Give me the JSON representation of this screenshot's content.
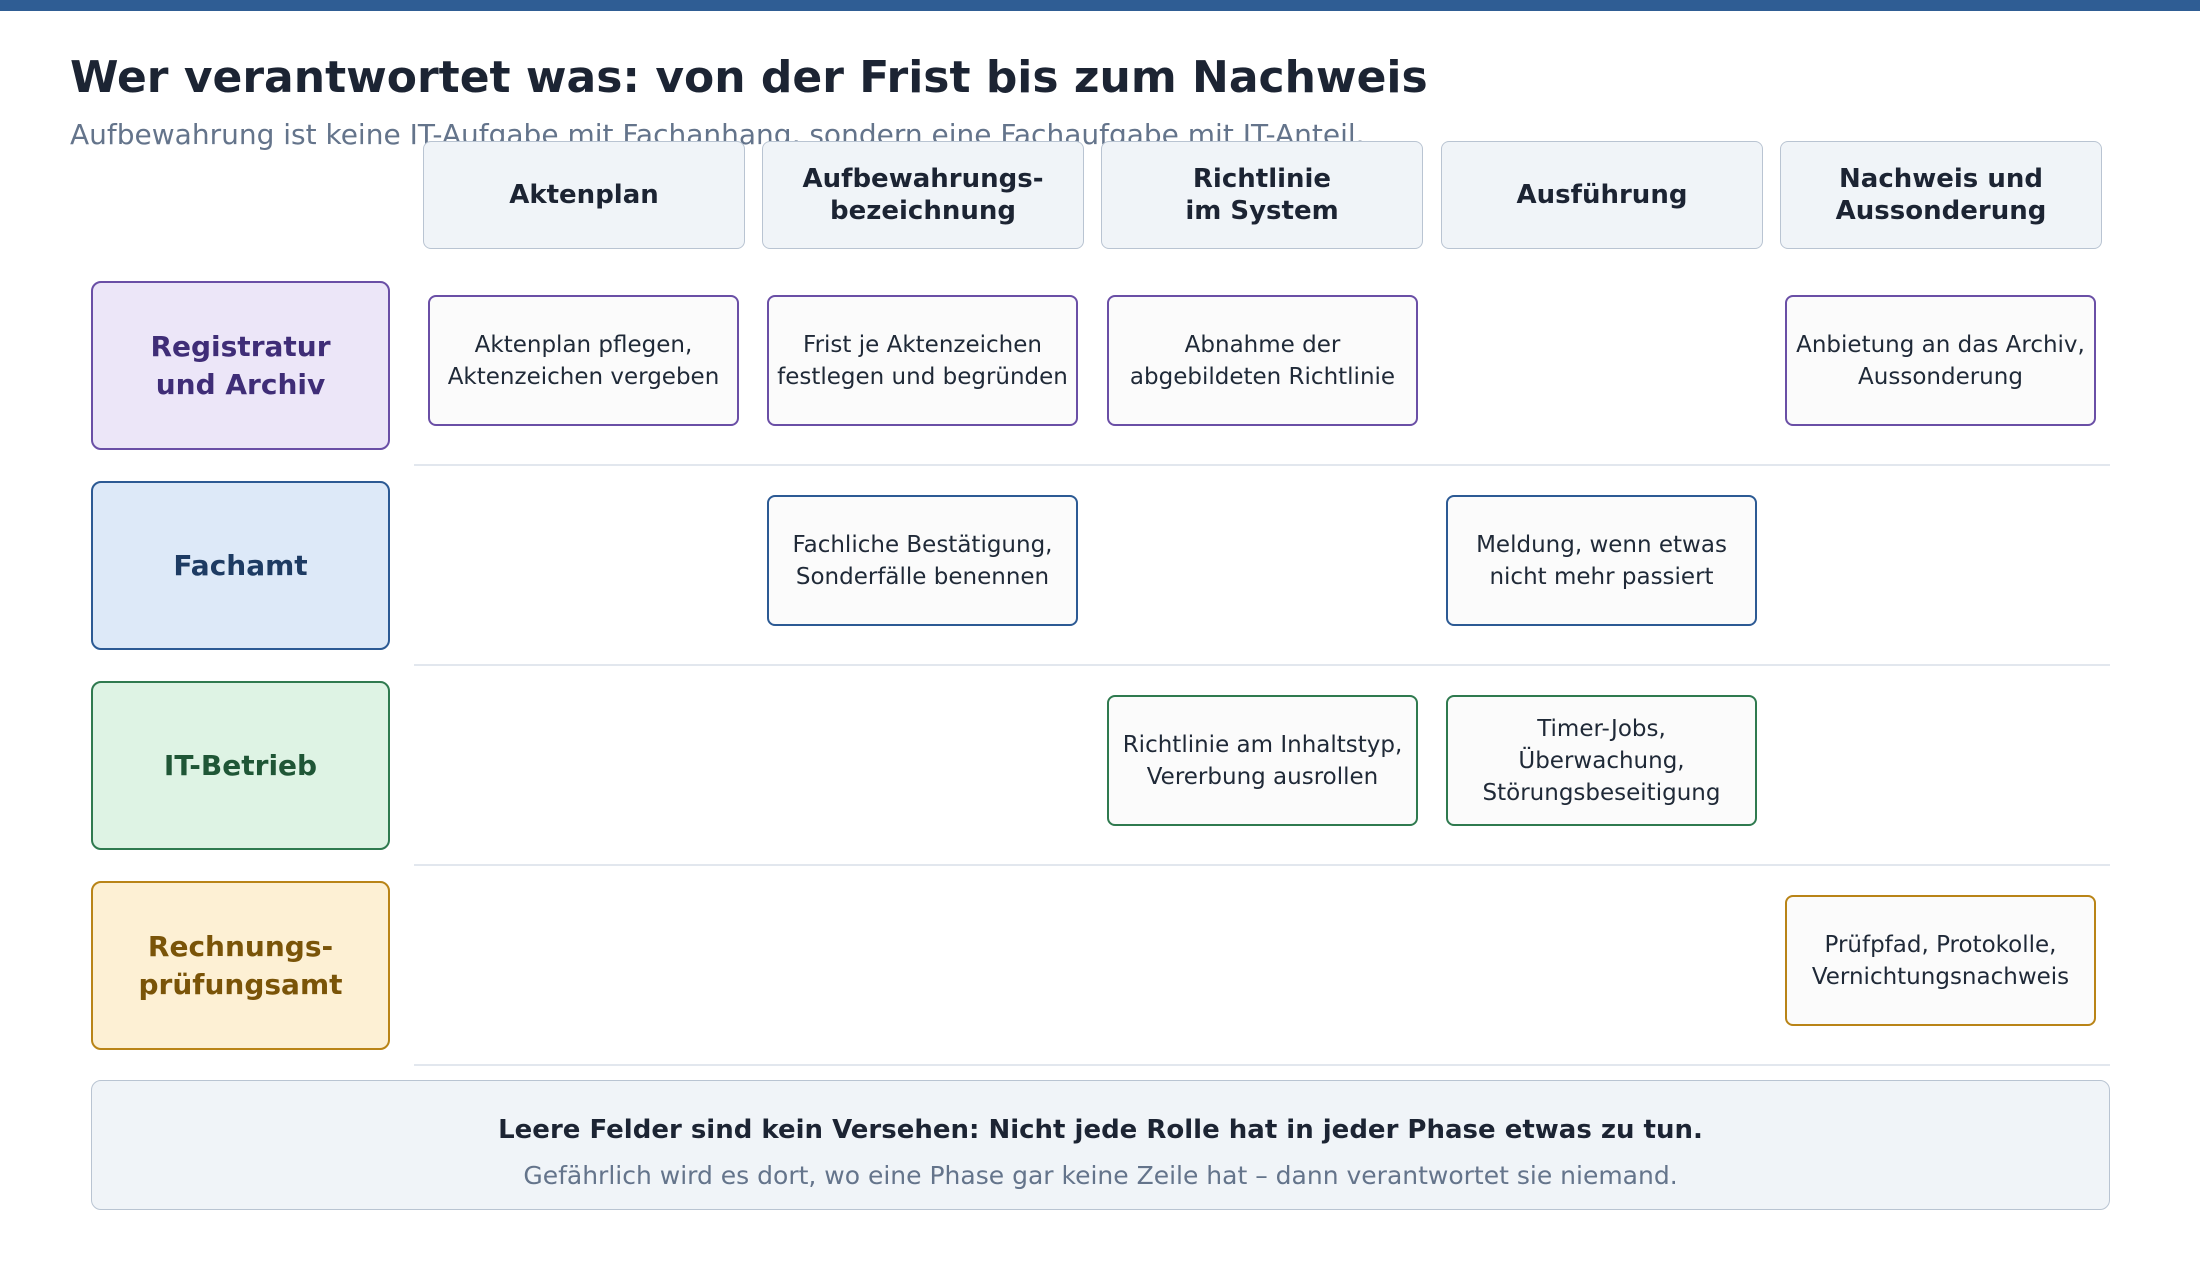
{
  "title": "Wer verantwortet was: von der Frist bis zum Nachweis",
  "subtitle": "Aufbewahrung ist keine IT-Aufgabe mit Fachanhang, sondern eine Fachaufgabe mit IT-Anteil.",
  "colors": {
    "top_bar": "#2f5d94",
    "registratur_border": "#6a4fa6",
    "registratur_fill": "#ece6f8",
    "registratur_text": "#3f2d77",
    "fachamt_border": "#2c5a94",
    "fachamt_fill": "#dde9f8",
    "fachamt_text": "#1d3b63",
    "it_border": "#2f7a4f",
    "it_fill": "#def3e4",
    "it_text": "#1f5636",
    "rpa_border": "#b98417",
    "rpa_fill": "#fdf0d4",
    "rpa_text": "#7a5408"
  },
  "phases": [
    {
      "label": "Aktenplan"
    },
    {
      "label": "Aufbewahrungs-\nbezeichnung"
    },
    {
      "label": "Richtlinie\nim System"
    },
    {
      "label": "Ausführung"
    },
    {
      "label": "Nachweis und\nAussonderung"
    }
  ],
  "roles": [
    {
      "label": "Registratur\nund Archiv",
      "cells": [
        "Aktenplan pflegen,\nAktenzeichen vergeben",
        "Frist je Aktenzeichen\nfestlegen und begründen",
        "Abnahme der\nabgebildeten Richtlinie",
        "",
        "Anbietung an das Archiv,\nAussonderung"
      ]
    },
    {
      "label": "Fachamt",
      "cells": [
        "",
        "Fachliche Bestätigung,\nSonderfälle benennen",
        "",
        "Meldung, wenn etwas\nnicht mehr passiert",
        ""
      ]
    },
    {
      "label": "IT-Betrieb",
      "cells": [
        "",
        "",
        "Richtlinie am Inhaltstyp,\nVererbung ausrollen",
        "Timer-Jobs, Überwachung,\nStörungsbeseitigung",
        ""
      ]
    },
    {
      "label": "Rechnungs-\nprüfungsamt",
      "cells": [
        "",
        "",
        "",
        "",
        "Prüfpfad, Protokolle,\nVernichtungsnachweis"
      ]
    }
  ],
  "note": {
    "main": "Leere Felder sind kein Versehen: Nicht jede Rolle hat in jeder Phase etwas zu tun.",
    "sub": "Gefährlich wird es dort, wo eine Phase gar keine Zeile hat – dann verantwortet sie niemand."
  }
}
